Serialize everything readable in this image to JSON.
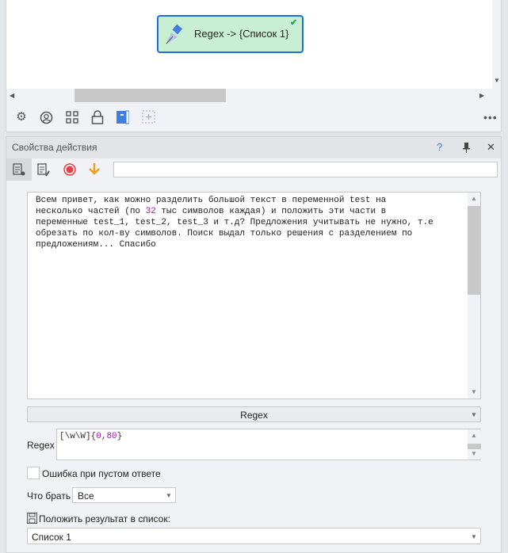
{
  "canvas": {
    "node_label": "Regex -> {Список 1}",
    "node_status_icon": "check-icon",
    "toolbar_icons": [
      "gear-icon",
      "user-circle-icon",
      "grid-icon",
      "lock-icon",
      "book-icon",
      "add-dashed-icon",
      "more-icon"
    ]
  },
  "properties": {
    "title": "Свойства действия",
    "help": "?",
    "pin_icon": "pin-icon",
    "close": "✕",
    "search_value": "",
    "input_text_before": "Всем привет, как можно разделить большой текст в переменной test на\nнесколько частей (по ",
    "input_text_number": "32",
    "input_text_after": " тыс символов каждая) и положить эти части в\nпеременные test_1, test_2, test_3 и т.д? Предложения учитывать не нужно, т.е\nобрезать по кол-ву символов. Поиск выдал только решения с разделением по\nпредложениям... Спасибо",
    "mode_select": "Regex",
    "regex_label": "Regex",
    "regex_prefix": "[\\w\\W]{",
    "regex_n1": "0",
    "regex_comma": ",",
    "regex_n2": "80",
    "regex_suffix": "}",
    "error_checkbox_label": "Ошибка при пустом ответе",
    "error_checked": false,
    "take_label": "Что брать",
    "take_value": "Все",
    "save_label": "Положить результат в список:",
    "list_value": "Список 1"
  }
}
